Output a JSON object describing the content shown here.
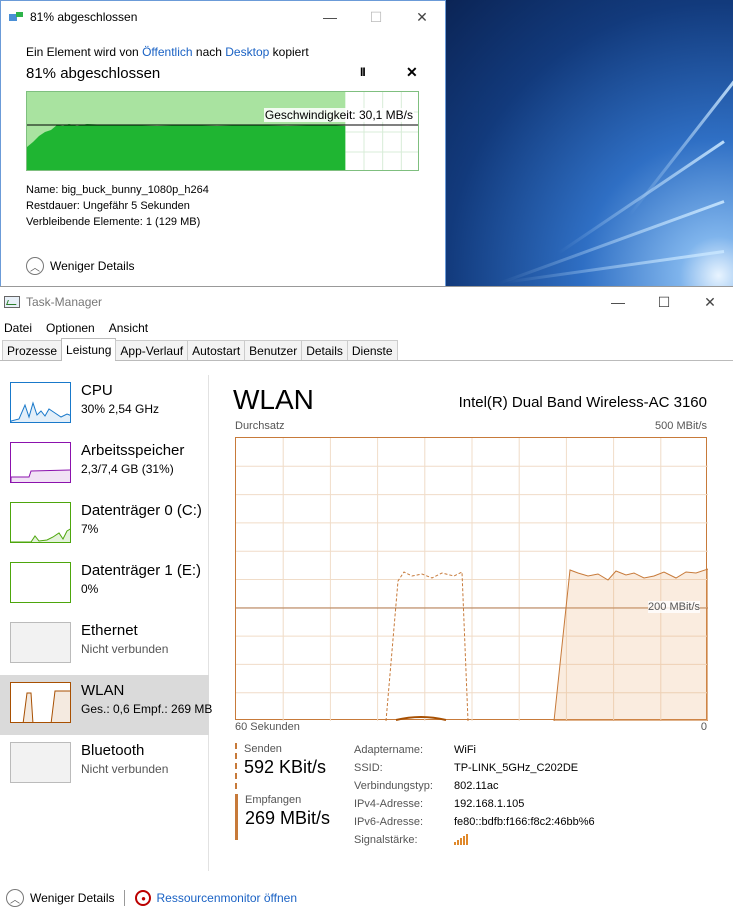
{
  "copy_dialog": {
    "title": "81% abgeschlossen",
    "minimize": "—",
    "maximize": "☐",
    "close": "✕",
    "subtitle_prefix": "Ein Element wird von",
    "source": "Öffentlich",
    "middle": "nach",
    "destination": "Desktop",
    "suffix": "kopiert",
    "progress_heading": "81% abgeschlossen",
    "progress_percent": 81,
    "pause": "II",
    "cancel": "✕",
    "speed": "Geschwindigkeit: 30,1 MB/s",
    "name": "Name:  big_buck_bunny_1080p_h264",
    "remaining_time": "Restdauer:  Ungefähr 5 Sekunden",
    "remaining_items": "Verbleibende Elemente:  1 (129 MB)",
    "fewer_details": "Weniger Details"
  },
  "task_manager": {
    "title": "Task-Manager",
    "minimize": "—",
    "maximize": "☐",
    "close": "✕",
    "menu": [
      "Datei",
      "Optionen",
      "Ansicht"
    ],
    "tabs": [
      "Prozesse",
      "Leistung",
      "App-Verlauf",
      "Autostart",
      "Benutzer",
      "Details",
      "Dienste"
    ],
    "active_tab": "Leistung",
    "sidebar": [
      {
        "name": "CPU",
        "value": "30%  2,54 GHz",
        "color": "#1979ca"
      },
      {
        "name": "Arbeitsspeicher",
        "value": "2,3/7,4 GB (31%)",
        "color": "#8b12ae"
      },
      {
        "name": "Datenträger 0 (C:)",
        "value": "7%",
        "color": "#4da60c"
      },
      {
        "name": "Datenträger 1 (E:)",
        "value": "0%",
        "color": "#4da60c"
      },
      {
        "name": "Ethernet",
        "value": "Nicht verbunden",
        "color": "#999999"
      },
      {
        "name": "WLAN",
        "value": "Ges.: 0,6  Empf.: 269 MB",
        "color": "#a74f01"
      },
      {
        "name": "Bluetooth",
        "value": "Nicht verbunden",
        "color": "#999999"
      }
    ],
    "main": {
      "title": "WLAN",
      "adapter": "Intel(R) Dual Band Wireless-AC 3160",
      "throughput_label": "Durchsatz",
      "max_label": "500 MBit/s",
      "mid_label": "200 MBit/s",
      "x_left": "60 Sekunden",
      "x_right": "0",
      "send_label": "Senden",
      "send_value": "592 KBit/s",
      "recv_label": "Empfangen",
      "recv_value": "269 MBit/s",
      "details": [
        {
          "k": "Adaptername:",
          "v": "WiFi"
        },
        {
          "k": "SSID:",
          "v": "TP-LINK_5GHz_C202DE"
        },
        {
          "k": "Verbindungstyp:",
          "v": "802.11ac"
        },
        {
          "k": "IPv4-Adresse:",
          "v": "192.168.1.105"
        },
        {
          "k": "IPv6-Adresse:",
          "v": "fe80::bdfb:f166:f8c2:46bb%6"
        },
        {
          "k": "Signalstärke:",
          "v": ""
        }
      ]
    },
    "footer": {
      "fewer_details": "Weniger Details",
      "resource_monitor": "Ressourcenmonitor öffnen"
    }
  }
}
